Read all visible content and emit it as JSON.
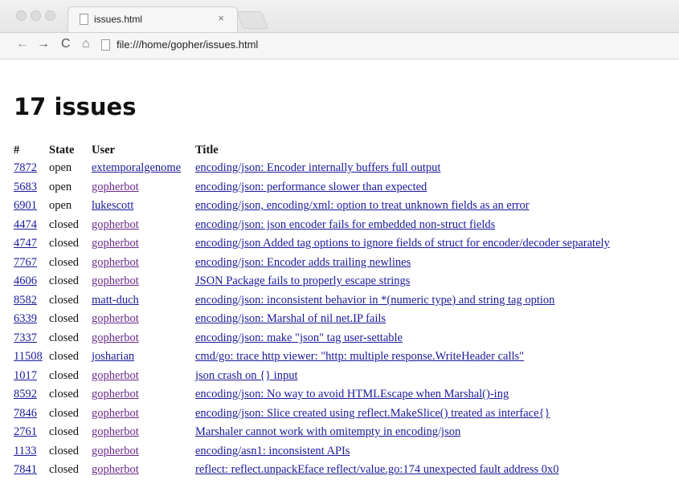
{
  "browser": {
    "tab_title": "issues.html",
    "tab_close": "×",
    "address": "file:///home/gopher/issues.html"
  },
  "page": {
    "heading": "17 issues",
    "columns": [
      "#",
      "State",
      "User",
      "Title"
    ],
    "issues": [
      {
        "number": "7872",
        "state": "open",
        "user": "extemporalgenome",
        "title": "encoding/json: Encoder internally buffers full output"
      },
      {
        "number": "5683",
        "state": "open",
        "user": "gopherbot",
        "title": "encoding/json: performance slower than expected"
      },
      {
        "number": "6901",
        "state": "open",
        "user": "lukescott",
        "title": "encoding/json, encoding/xml: option to treat unknown fields as an error"
      },
      {
        "number": "4474",
        "state": "closed",
        "user": "gopherbot",
        "title": "encoding/json: json encoder fails for embedded non-struct fields"
      },
      {
        "number": "4747",
        "state": "closed",
        "user": "gopherbot",
        "title": "encoding/json Added tag options to ignore fields of struct for encoder/decoder separately"
      },
      {
        "number": "7767",
        "state": "closed",
        "user": "gopherbot",
        "title": "encoding/json: Encoder adds trailing newlines"
      },
      {
        "number": "4606",
        "state": "closed",
        "user": "gopherbot",
        "title": "JSON Package fails to properly escape strings"
      },
      {
        "number": "8582",
        "state": "closed",
        "user": "matt-duch",
        "title": "encoding/json: inconsistent behavior in *(numeric type) and string tag option"
      },
      {
        "number": "6339",
        "state": "closed",
        "user": "gopherbot",
        "title": "encoding/json: Marshal of nil net.IP fails"
      },
      {
        "number": "7337",
        "state": "closed",
        "user": "gopherbot",
        "title": "encoding/json: make \"json\" tag user-settable"
      },
      {
        "number": "11508",
        "state": "closed",
        "user": "josharian",
        "title": "cmd/go: trace http viewer: \"http: multiple response.WriteHeader calls\""
      },
      {
        "number": "1017",
        "state": "closed",
        "user": "gopherbot",
        "title": "json crash on {} input"
      },
      {
        "number": "8592",
        "state": "closed",
        "user": "gopherbot",
        "title": "encoding/json: No way to avoid HTMLEscape when Marshal()-ing"
      },
      {
        "number": "7846",
        "state": "closed",
        "user": "gopherbot",
        "title": "encoding/json: Slice created using reflect.MakeSlice() treated as interface{}"
      },
      {
        "number": "2761",
        "state": "closed",
        "user": "gopherbot",
        "title": "Marshaler cannot work with omitempty in encoding/json"
      },
      {
        "number": "1133",
        "state": "closed",
        "user": "gopherbot",
        "title": "encoding/asn1: inconsistent APIs"
      },
      {
        "number": "7841",
        "state": "closed",
        "user": "gopherbot",
        "title": "reflect: reflect.unpackEface reflect/value.go:174 unexpected fault address 0x0"
      }
    ]
  },
  "icons": {
    "back": "left-arrow-icon",
    "forward": "right-arrow-icon",
    "reload": "reload-icon",
    "home": "home-icon",
    "page": "page-icon"
  },
  "colors": {
    "link": "#1a1a9a",
    "visited_link": "#6a2a8a"
  }
}
